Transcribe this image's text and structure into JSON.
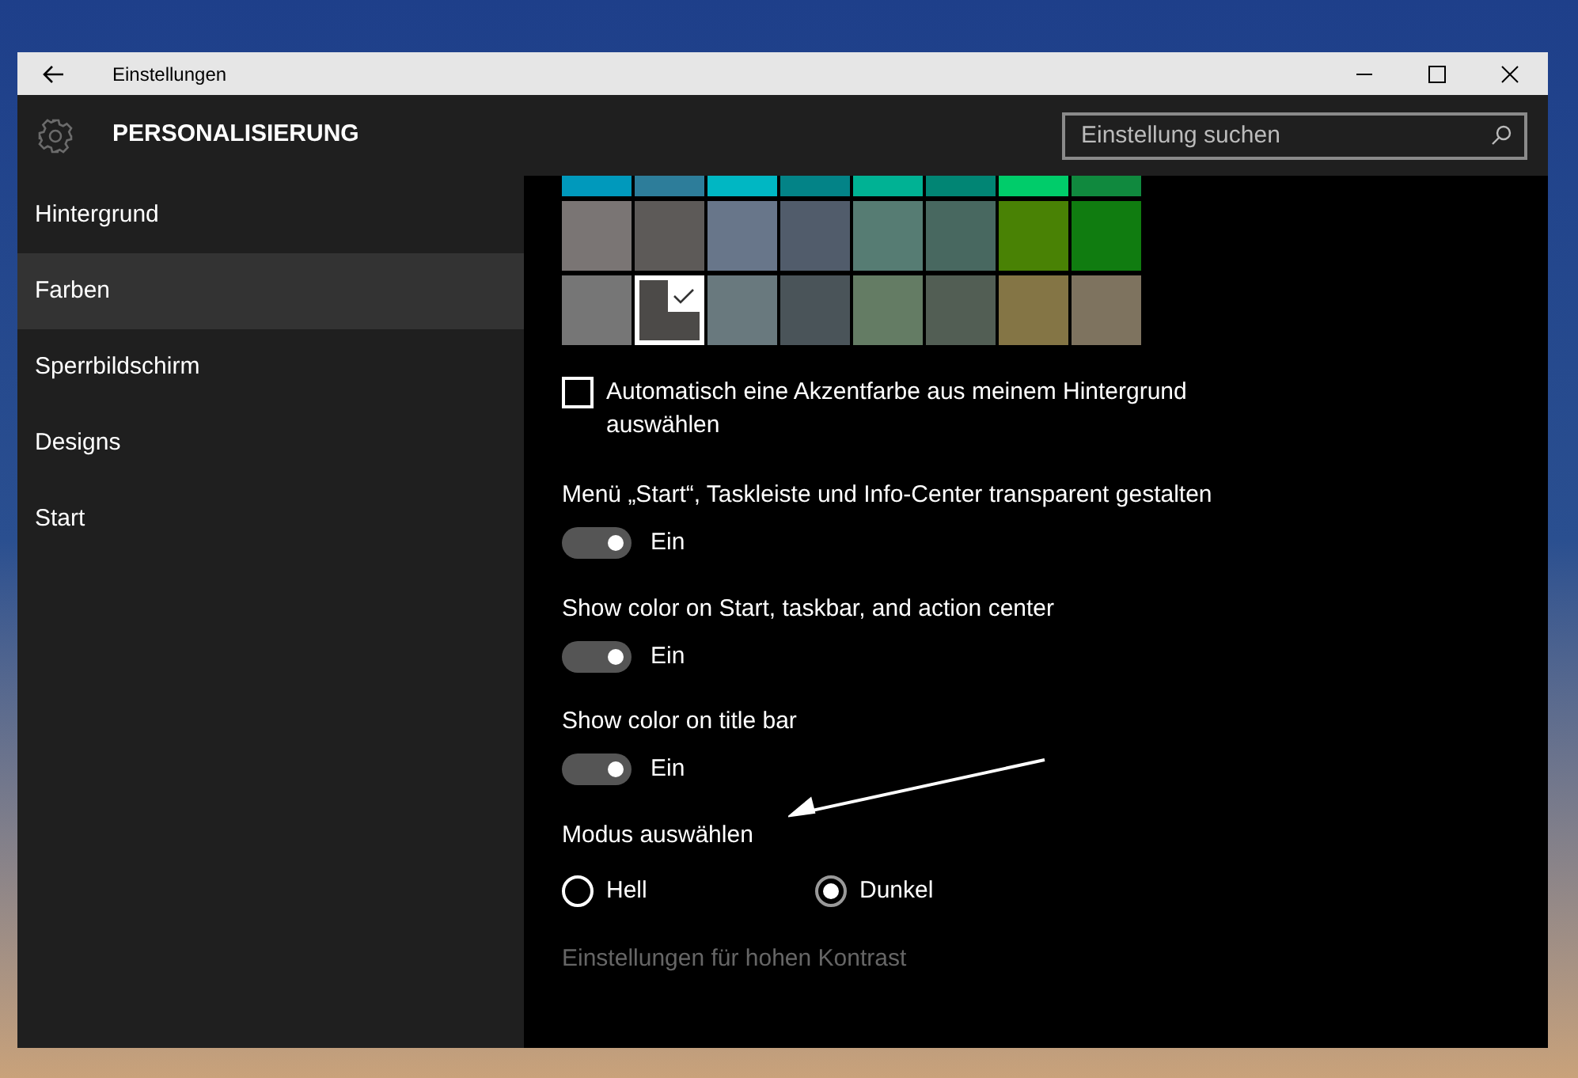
{
  "window": {
    "title": "Einstellungen"
  },
  "header": {
    "title": "PERSONALISIERUNG",
    "search": {
      "placeholder": "Einstellung suchen"
    }
  },
  "sidebar": {
    "items": [
      {
        "label": "Hintergrund",
        "selected": false
      },
      {
        "label": "Farben",
        "selected": true
      },
      {
        "label": "Sperrbildschirm",
        "selected": false
      },
      {
        "label": "Designs",
        "selected": false
      },
      {
        "label": "Start",
        "selected": false
      }
    ]
  },
  "swatch_rows": [
    [
      {
        "color": "#0099bc",
        "selected": false
      },
      {
        "color": "#2d7d9a",
        "selected": false
      },
      {
        "color": "#00b7c3",
        "selected": false
      },
      {
        "color": "#038387",
        "selected": false
      },
      {
        "color": "#00b294",
        "selected": false
      },
      {
        "color": "#018574",
        "selected": false
      },
      {
        "color": "#00cc6a",
        "selected": false
      },
      {
        "color": "#10893e",
        "selected": false
      }
    ],
    [
      {
        "color": "#7a7574",
        "selected": false
      },
      {
        "color": "#5d5a58",
        "selected": false
      },
      {
        "color": "#68768a",
        "selected": false
      },
      {
        "color": "#515c6b",
        "selected": false
      },
      {
        "color": "#567c73",
        "selected": false
      },
      {
        "color": "#486860",
        "selected": false
      },
      {
        "color": "#498205",
        "selected": false
      },
      {
        "color": "#107c10",
        "selected": false
      }
    ],
    [
      {
        "color": "#767676",
        "selected": false
      },
      {
        "color": "#4c4a48",
        "selected": true
      },
      {
        "color": "#69797e",
        "selected": false
      },
      {
        "color": "#4a5459",
        "selected": false
      },
      {
        "color": "#647c64",
        "selected": false
      },
      {
        "color": "#525e54",
        "selected": false
      },
      {
        "color": "#847545",
        "selected": false
      },
      {
        "color": "#7e735f",
        "selected": false
      }
    ]
  ],
  "auto_accent": {
    "label": "Automatisch eine Akzentfarbe aus meinem Hintergrund auswählen",
    "checked": false
  },
  "toggles": [
    {
      "label": "Menü „Start“, Taskleiste und Info-Center transparent gestalten",
      "on": true,
      "state_text": "Ein"
    },
    {
      "label": "Show color on Start, taskbar, and action center",
      "on": true,
      "state_text": "Ein"
    },
    {
      "label": "Show color on title bar",
      "on": true,
      "state_text": "Ein"
    }
  ],
  "mode": {
    "title": "Modus auswählen",
    "options": [
      {
        "label": "Hell",
        "selected": false
      },
      {
        "label": "Dunkel",
        "selected": true
      }
    ]
  },
  "high_contrast_link": "Einstellungen für hohen Kontrast"
}
